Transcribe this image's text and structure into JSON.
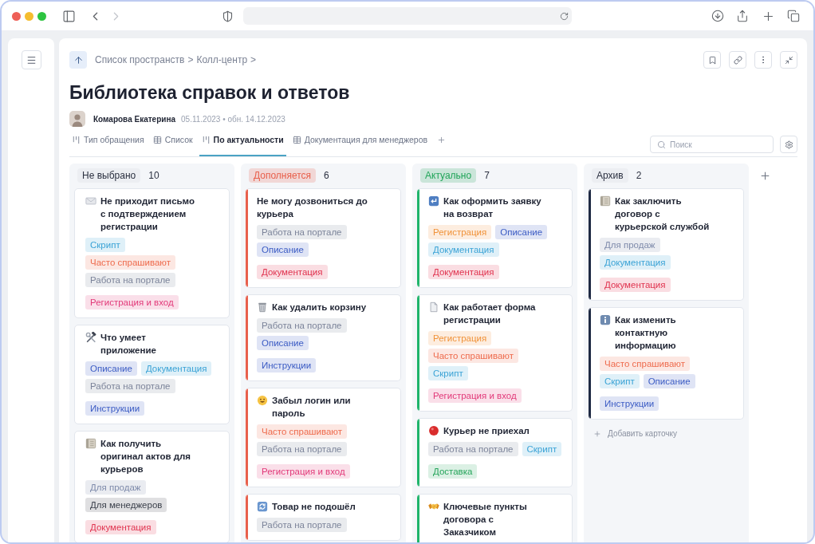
{
  "browser": {
    "back": {
      "disabled": false
    },
    "forward": {
      "disabled": true
    }
  },
  "breadcrumb": {
    "items": [
      "Список пространств",
      "Колл-центр"
    ],
    "separator": ">"
  },
  "page": {
    "title": "Библиотека справок и ответов",
    "author": "Комарова Екатерина",
    "dates": "05.11.2023 • обн. 14.12.2023"
  },
  "views": [
    {
      "label": "Тип обращения",
      "kind": "board",
      "selected": false
    },
    {
      "label": "Список",
      "kind": "table",
      "selected": false
    },
    {
      "label": "По актуальности",
      "kind": "board",
      "selected": true
    },
    {
      "label": "Документация для менеджеров",
      "kind": "table",
      "selected": false
    }
  ],
  "search": {
    "placeholder": "Поиск"
  },
  "columns": [
    {
      "title": "Не выбрано",
      "count": "10",
      "cards": [
        {
          "kind": "envelope",
          "title": "Не приходит письмо с подтверждением регистрации",
          "tag_rows": [
            [
              {
                "label": "Скрипт",
                "color": "#3ba3d6"
              }
            ],
            [
              {
                "label": "Часто спрашивают",
                "color": "#ee6b4d"
              }
            ],
            [
              {
                "label": "Работа на портале",
                "color": "#7c849a"
              }
            ]
          ],
          "category": {
            "label": "Регистрация и вход",
            "color": "#e23a7a"
          }
        },
        {
          "kind": "tools",
          "title": "Что умеет приложение",
          "tag_rows": [
            [
              {
                "label": "Описание",
                "color": "#3c5cc4"
              },
              {
                "label": "Документация",
                "color": "#3ba3d6"
              }
            ],
            [
              {
                "label": "Работа на портале",
                "color": "#7c849a"
              }
            ]
          ],
          "category": {
            "label": "Инструкции",
            "color": "#3c5cc4"
          }
        },
        {
          "kind": "notebook",
          "title": "Как получить оригинал актов для курьеров",
          "tag_rows": [
            [
              {
                "label": "Для продаж",
                "color": "#7f8bab"
              }
            ],
            [
              {
                "label": "Для менеджеров",
                "color": "#3a3f4a"
              }
            ]
          ],
          "category": {
            "label": "Документация",
            "color": "#e0334f"
          }
        }
      ]
    },
    {
      "title": "Дополняется",
      "count": "6",
      "color": "#e8604c",
      "cards": [
        {
          "kind": "plain",
          "color": "#e8604c",
          "title": "Не могу дозвониться до курьера",
          "tag_rows": [
            [
              {
                "label": "Работа на портале",
                "color": "#7c849a"
              }
            ],
            [
              {
                "label": "Описание",
                "color": "#3c5cc4"
              }
            ]
          ],
          "category": {
            "label": "Документация",
            "color": "#e0334f"
          }
        },
        {
          "kind": "wastebasket",
          "color": "#e8604c",
          "title": "Как удалить корзину",
          "tag_rows": [
            [
              {
                "label": "Работа на портале",
                "color": "#7c849a"
              }
            ],
            [
              {
                "label": "Описание",
                "color": "#3c5cc4"
              }
            ]
          ],
          "category": {
            "label": "Инструкции",
            "color": "#3c5cc4"
          }
        },
        {
          "kind": "smiley",
          "color": "#e8604c",
          "title": "Забыл логин или пароль",
          "tag_rows": [
            [
              {
                "label": "Часто спрашивают",
                "color": "#ee6b4d"
              }
            ],
            [
              {
                "label": "Работа на портале",
                "color": "#7c849a"
              }
            ]
          ],
          "category": {
            "label": "Регистрация и вход",
            "color": "#e23a7a"
          }
        },
        {
          "kind": "cycle",
          "color": "#e8604c",
          "title": "Товар не подошёл",
          "tag_rows": [
            [
              {
                "label": "Работа на портале",
                "color": "#7c849a"
              }
            ]
          ]
        }
      ]
    },
    {
      "title": "Актуально",
      "count": "7",
      "color": "#22a55a",
      "cards": [
        {
          "kind": "return",
          "color": "#1fb46b",
          "title": "Как оформить заявку на возврат",
          "tag_rows": [
            [
              {
                "label": "Регистрация",
                "color": "#f0933a"
              },
              {
                "label": "Описание",
                "color": "#3c5cc4"
              }
            ],
            [
              {
                "label": "Документация",
                "color": "#3ba3d6"
              }
            ]
          ],
          "category": {
            "label": "Документация",
            "color": "#e0334f"
          }
        },
        {
          "kind": "document",
          "color": "#1fb46b",
          "title": "Как работает форма регистрации",
          "tag_rows": [
            [
              {
                "label": "Регистрация",
                "color": "#f0933a"
              }
            ],
            [
              {
                "label": "Часто спрашивают",
                "color": "#ee6b4d"
              }
            ],
            [
              {
                "label": "Скрипт",
                "color": "#3ba3d6"
              }
            ]
          ],
          "category": {
            "label": "Регистрация и вход",
            "color": "#e23a7a"
          }
        },
        {
          "kind": "dot",
          "color": "#1fb46b",
          "title": "Курьер не приехал",
          "tag_rows": [
            [
              {
                "label": "Работа на портале",
                "color": "#7c849a"
              },
              {
                "label": "Скрипт",
                "color": "#3ba3d6"
              }
            ]
          ],
          "category": {
            "label": "Доставка",
            "color": "#26a55b"
          }
        },
        {
          "kind": "handshake",
          "color": "#1fb46b",
          "title": "Ключевые пункты договора с Заказчиком"
        }
      ]
    },
    {
      "title": "Архив",
      "count": "2",
      "add_card": "Добавить карточку",
      "cards": [
        {
          "kind": "notebook",
          "color": "#1f2a44",
          "title": "Как заключить договор с курьерской службой",
          "tag_rows": [
            [
              {
                "label": "Для продаж",
                "color": "#7f8bab"
              }
            ],
            [
              {
                "label": "Документация",
                "color": "#3ba3d6"
              }
            ]
          ],
          "category": {
            "label": "Документация",
            "color": "#e0334f"
          }
        },
        {
          "kind": "info",
          "color": "#1f2a44",
          "title": "Как изменить контактную информацию",
          "tag_rows": [
            [
              {
                "label": "Часто спрашивают",
                "color": "#ee6b4d"
              }
            ],
            [
              {
                "label": "Скрипт",
                "color": "#3ba3d6"
              },
              {
                "label": "Описание",
                "color": "#3c5cc4"
              }
            ]
          ],
          "category": {
            "label": "Инструкции",
            "color": "#3c5cc4"
          }
        }
      ]
    }
  ]
}
